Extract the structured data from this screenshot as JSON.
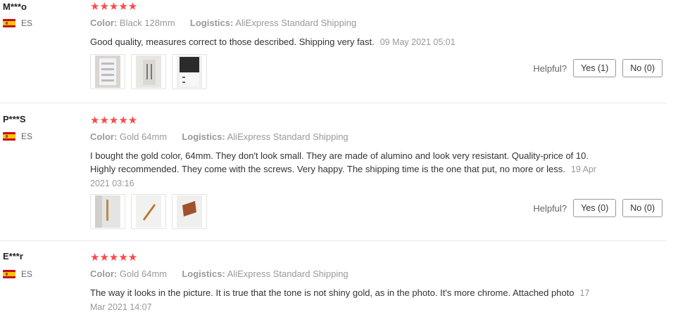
{
  "reviews": [
    {
      "user": "M***o",
      "country": "ES",
      "stars": "★★★★★",
      "color_label": "Color:",
      "color_value": "Black 128mm",
      "logistics_label": "Logistics:",
      "logistics_value": "AliExpress Standard Shipping",
      "text": "Good quality, measures correct to those described. Shipping very fast.",
      "date": "09 May 2021 05:01",
      "helpful_label": "Helpful?",
      "yes_label": "Yes (1)",
      "no_label": "No (0)",
      "photos": [
        "photo-1",
        "photo-2",
        "photo-3"
      ]
    },
    {
      "user": "P***S",
      "country": "ES",
      "stars": "★★★★★",
      "color_label": "Color:",
      "color_value": "Gold 64mm",
      "logistics_label": "Logistics:",
      "logistics_value": "AliExpress Standard Shipping",
      "text": "I bought the gold color, 64mm. They don't look small. They are made of alumino and look very resistant. Quality-price of 10. Highly recommended. They come with the screws. Very happy. The shipping time is the one that put, no more or less.",
      "date": "19 Apr 2021 03:16",
      "helpful_label": "Helpful?",
      "yes_label": "Yes (0)",
      "no_label": "No (0)",
      "photos": [
        "photo-1",
        "photo-2",
        "photo-3"
      ]
    },
    {
      "user": "E***r",
      "country": "ES",
      "stars": "★★★★★",
      "color_label": "Color:",
      "color_value": "Gold 64mm",
      "logistics_label": "Logistics:",
      "logistics_value": "AliExpress Standard Shipping",
      "text": "The way it looks in the picture. It is true that the tone is not shiny gold, as in the photo. It's more chrome. Attached photo",
      "date": "17 Mar 2021 14:07"
    }
  ],
  "colors": {
    "star": "#ff4747",
    "muted": "#999999",
    "divider": "#e8e8e8"
  }
}
